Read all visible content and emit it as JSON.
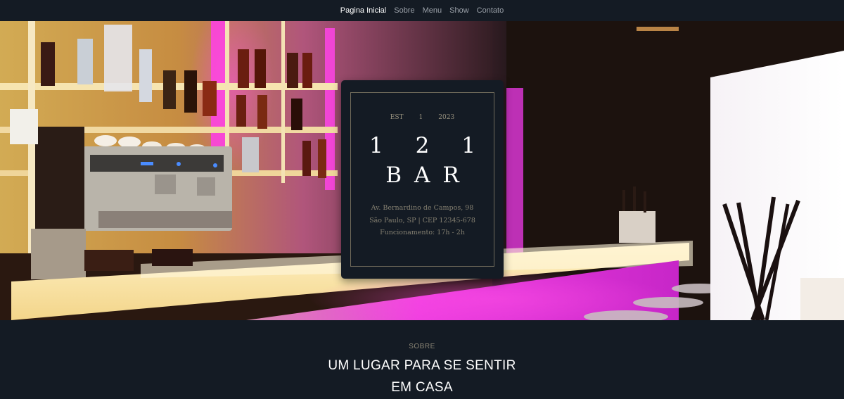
{
  "nav": {
    "items": [
      {
        "label": "Pagina Inicial",
        "active": true
      },
      {
        "label": "Sobre"
      },
      {
        "label": "Menu"
      },
      {
        "label": "Show"
      },
      {
        "label": "Contato"
      }
    ]
  },
  "hero": {
    "est_label": "EST",
    "est_day": "1",
    "est_year": "2023",
    "name_line1": "1 2 1",
    "name_line2": "BAR",
    "address_line1": "Av. Bernardino de Campos, 98",
    "address_line2": "São Paulo, SP | CEP 12345-678",
    "hours": "Funcionamento: 17h - 2h"
  },
  "about": {
    "label": "SOBRE",
    "heading_line1": "UM LUGAR PARA SE SENTIR",
    "heading_line2": "EM CASA"
  },
  "colors": {
    "background": "#141b24",
    "accent_pink": "#e43bd8",
    "card_border": "#6f6a5a"
  }
}
